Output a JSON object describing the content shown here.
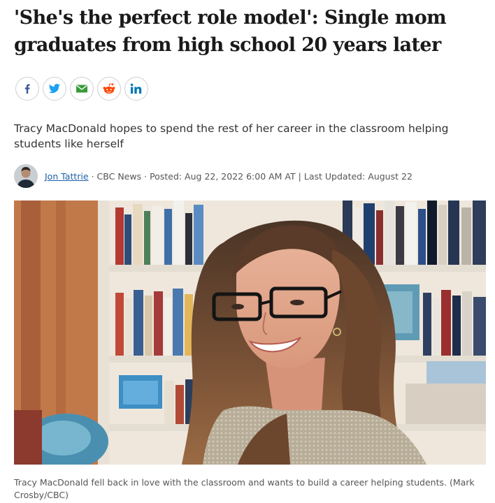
{
  "article": {
    "headline": "'She's the perfect role model': Single mom graduates from high school 20 years later",
    "deck": "Tracy MacDonald hopes to spend the rest of her career in the classroom helping students like herself",
    "byline": {
      "author": "Jon Tattrie",
      "separator": "·",
      "outlet": "CBC News",
      "posted": "Posted: Aug 22, 2022 6:00 AM AT",
      "divider": "|",
      "updated": "Last Updated: August 22"
    },
    "photo": {
      "caption": "Tracy MacDonald fell back in love with the classroom and wants to build a career helping students. (Mark Crosby/CBC)"
    }
  },
  "share": {
    "buttons": [
      {
        "icon": "facebook-icon",
        "color": "#3b5998"
      },
      {
        "icon": "twitter-icon",
        "color": "#1da1f2"
      },
      {
        "icon": "email-icon",
        "color": "#3a9a3a"
      },
      {
        "icon": "reddit-icon",
        "color": "#ff4500"
      },
      {
        "icon": "linkedin-icon",
        "color": "#0077b5"
      }
    ]
  }
}
